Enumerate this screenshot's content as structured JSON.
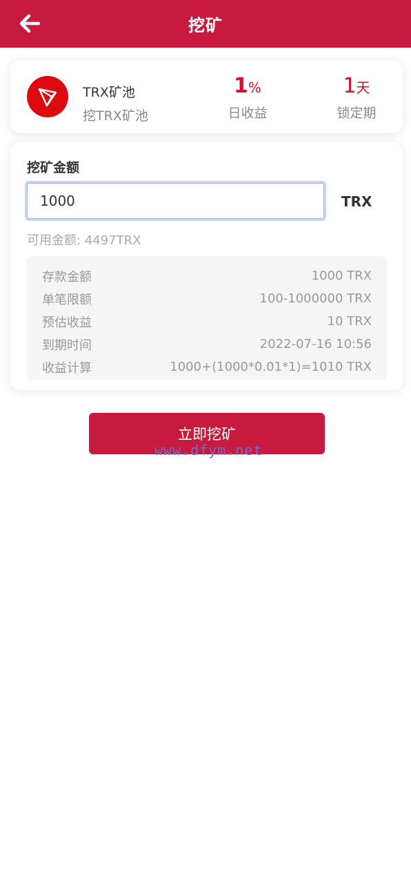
{
  "header": {
    "title": "挖矿"
  },
  "pool": {
    "name": "TRX矿池",
    "subtitle": "挖TRX矿池",
    "rate_value": "1",
    "rate_unit": "%",
    "rate_label": "日收益",
    "lock_value": "1",
    "lock_unit": "天",
    "lock_label": "锁定期"
  },
  "form": {
    "title": "挖矿金额",
    "amount_value": "1000",
    "currency": "TRX",
    "available_label": "可用金额:",
    "available_value": "4497TRX"
  },
  "details": [
    {
      "label": "存款金额",
      "value": "1000 TRX"
    },
    {
      "label": "单笔限额",
      "value": "100-1000000 TRX"
    },
    {
      "label": "预估收益",
      "value": "10 TRX"
    },
    {
      "label": "到期时间",
      "value": "2022-07-16 10:56"
    },
    {
      "label": "收益计算",
      "value": "1000+(1000*0.01*1)=1010 TRX"
    }
  ],
  "action": {
    "label": "立即挖矿"
  },
  "watermark": "www.dfym.net",
  "colors": {
    "brand": "#c71a3e",
    "accent": "#d40f2a",
    "tron_red": "#de0a10"
  },
  "icons": {
    "back": "arrow-left-icon",
    "logo": "tron-logo-icon"
  }
}
